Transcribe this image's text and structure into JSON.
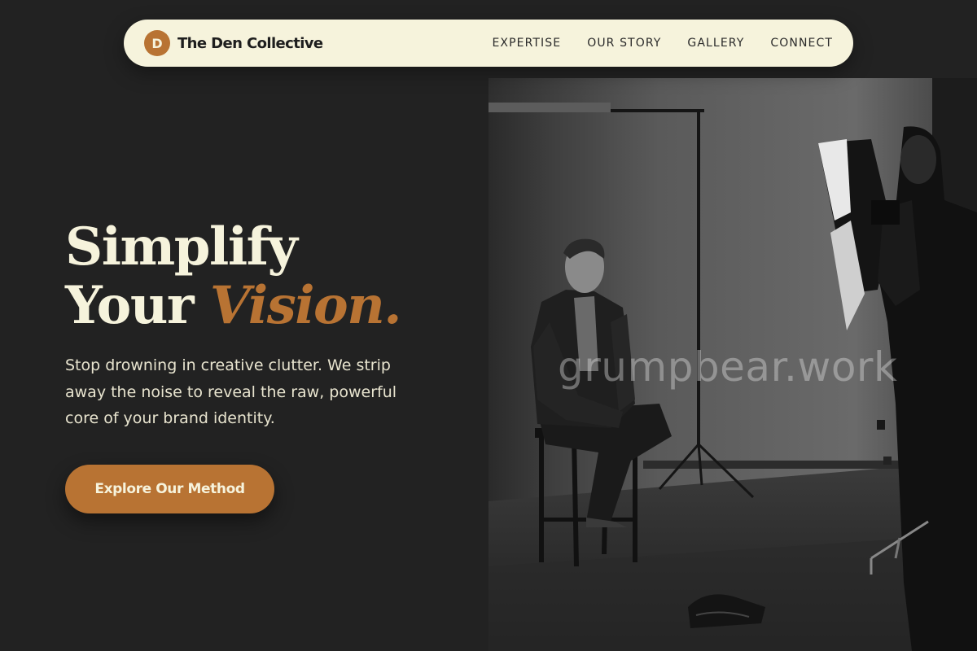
{
  "nav": {
    "logo_letter": "D",
    "brand_name": "The Den Collective",
    "links": [
      "EXPERTISE",
      "OUR STORY",
      "GALLERY",
      "CONNECT"
    ]
  },
  "hero": {
    "title_line1": "Simplify",
    "title_line2_plain": "Your ",
    "title_line2_accent": "Vision.",
    "subtitle": "Stop drowning in creative clutter. We strip away the noise to reveal the raw, powerful core of your brand identity.",
    "cta_label": "Explore Our Method"
  },
  "photo": {
    "description_icon": "photo-studio-portrait",
    "watermark": "grumpbear.work"
  },
  "colors": {
    "background": "#222222",
    "nav_bg": "#f6f3dc",
    "accent": "#b87333",
    "text_light": "#f6f3dc"
  }
}
